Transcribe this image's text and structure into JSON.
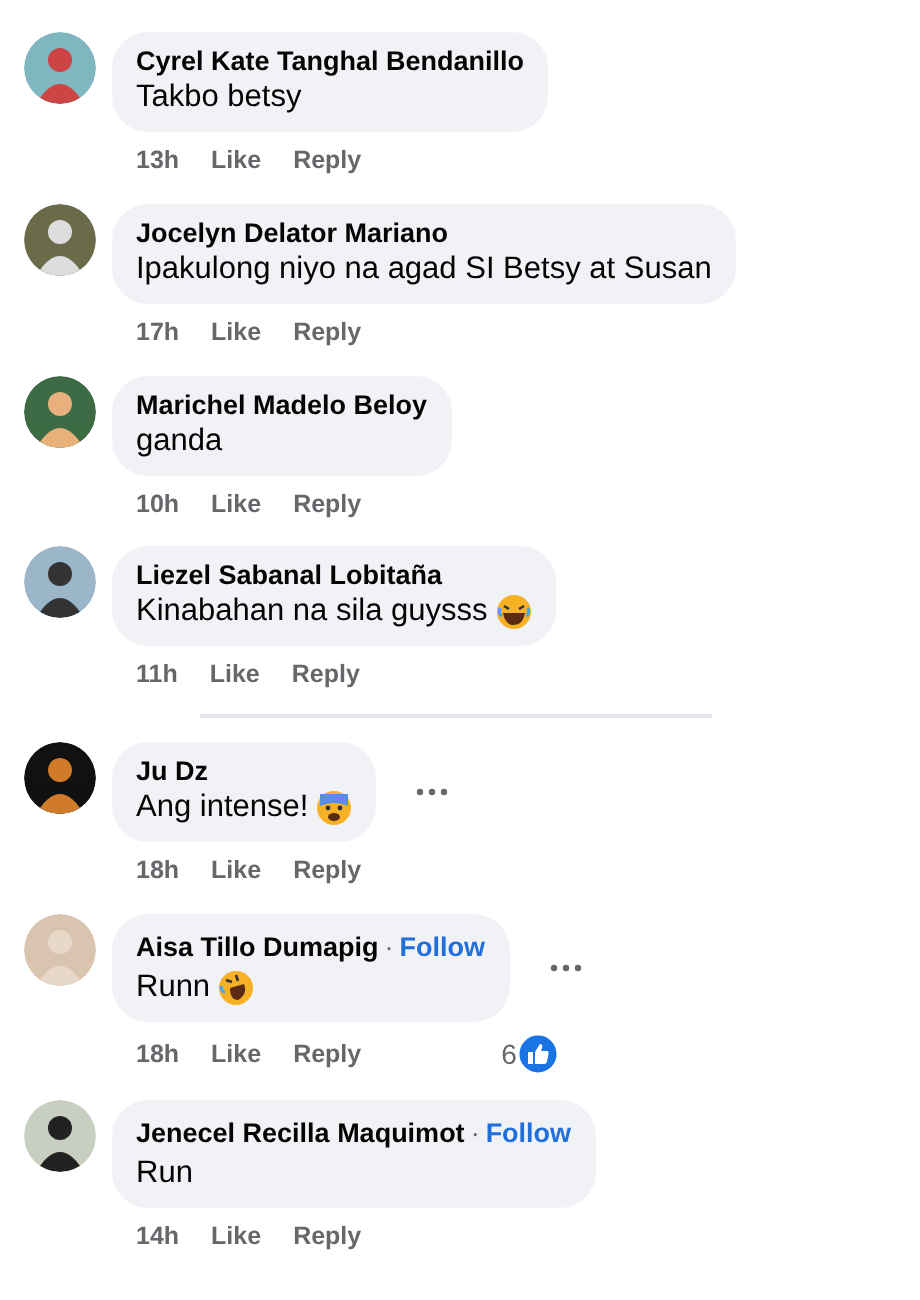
{
  "comments": [
    {
      "name": "Cyrel Kate Tanghal Bendanillo",
      "text": "Takbo betsy",
      "time": "13h",
      "like": "Like",
      "reply": "Reply",
      "more_menu": false,
      "divider_after": false
    },
    {
      "name": "Jocelyn Delator Mariano",
      "text": "Ipakulong niyo na agad SI Betsy at Susan",
      "time": "17h",
      "like": "Like",
      "reply": "Reply",
      "more_menu": false,
      "divider_after": false
    },
    {
      "name": "Marichel Madelo Beloy",
      "text": "ganda",
      "time": "10h",
      "like": "Like",
      "reply": "Reply",
      "more_menu": false,
      "divider_after": false
    },
    {
      "name": "Liezel Sabanal Lobitaña",
      "text": "Kinabahan na sila guysss",
      "emoji": {
        "kind": "laugh"
      },
      "time": "11h",
      "like": "Like",
      "reply": "Reply",
      "more_menu": false,
      "divider_after": true
    },
    {
      "name": "Ju Dz",
      "text": "Ang intense!",
      "emoji": {
        "kind": "fear"
      },
      "time": "18h",
      "like": "Like",
      "reply": "Reply",
      "more_menu": true,
      "divider_after": false
    },
    {
      "name": "Aisa Tillo Dumapig",
      "separator": "·",
      "follow": "Follow",
      "text": "Runn",
      "emoji": {
        "kind": "rofl"
      },
      "time": "18h",
      "like": "Like",
      "reply": "Reply",
      "more_menu": true,
      "reaction_count": "6",
      "divider_after": false
    },
    {
      "name": "Jenecel Recilla Maquimot",
      "separator": "·",
      "follow": "Follow",
      "text": "Run",
      "time": "14h",
      "like": "Like",
      "reply": "Reply",
      "more_menu": false,
      "divider_after": false
    }
  ]
}
